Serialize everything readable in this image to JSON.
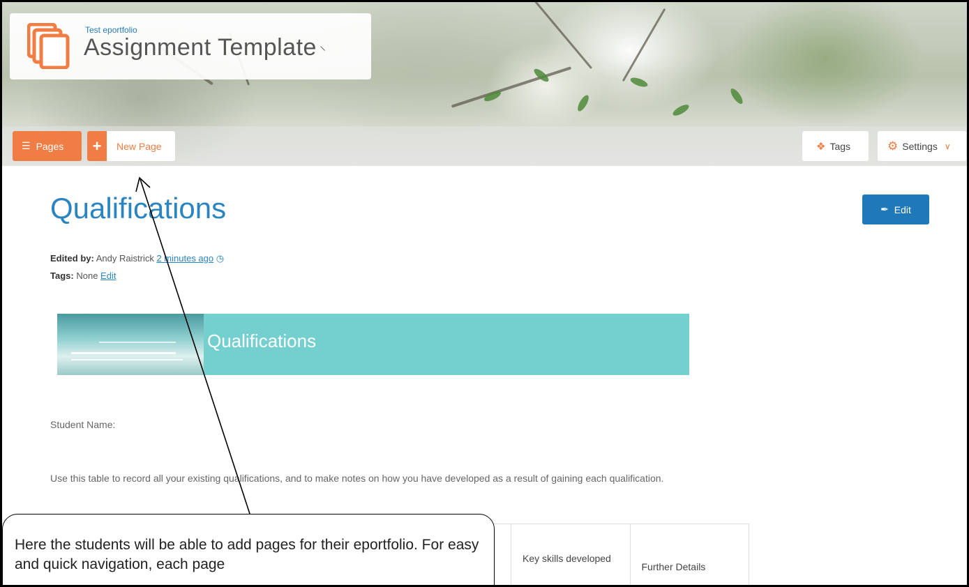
{
  "header": {
    "eportfolio_label": "Test eportfolio",
    "site_title": "Assignment Template",
    "rss_icon": "rss-icon"
  },
  "toolbar": {
    "pages_label": "Pages",
    "new_page_label": "New Page",
    "tags_label": "Tags",
    "settings_label": "Settings"
  },
  "page": {
    "title": "Qualifications",
    "edit_button_label": "Edit",
    "edited_by_label": "Edited by:",
    "edited_by_name": "Andy Raistrick",
    "edited_time": "2 minutes ago",
    "tags_label": "Tags:",
    "tags_value": "None",
    "tags_edit_link": "Edit",
    "banner_title": "Qualifications",
    "student_name_label": "Student Name:",
    "instructions": "Use this table to record all your existing qualifications, and to make notes on how you have developed as a result of gaining each qualification."
  },
  "table": {
    "headers": [
      "Key skills developed",
      "Further Details"
    ]
  },
  "callout": {
    "text": "Here the students will be able to add pages for their eportfolio. For easy and quick navigation, each page"
  },
  "colors": {
    "accent_orange": "#ef7d44",
    "accent_blue": "#1f78b8",
    "banner_teal": "#74cfcf"
  }
}
